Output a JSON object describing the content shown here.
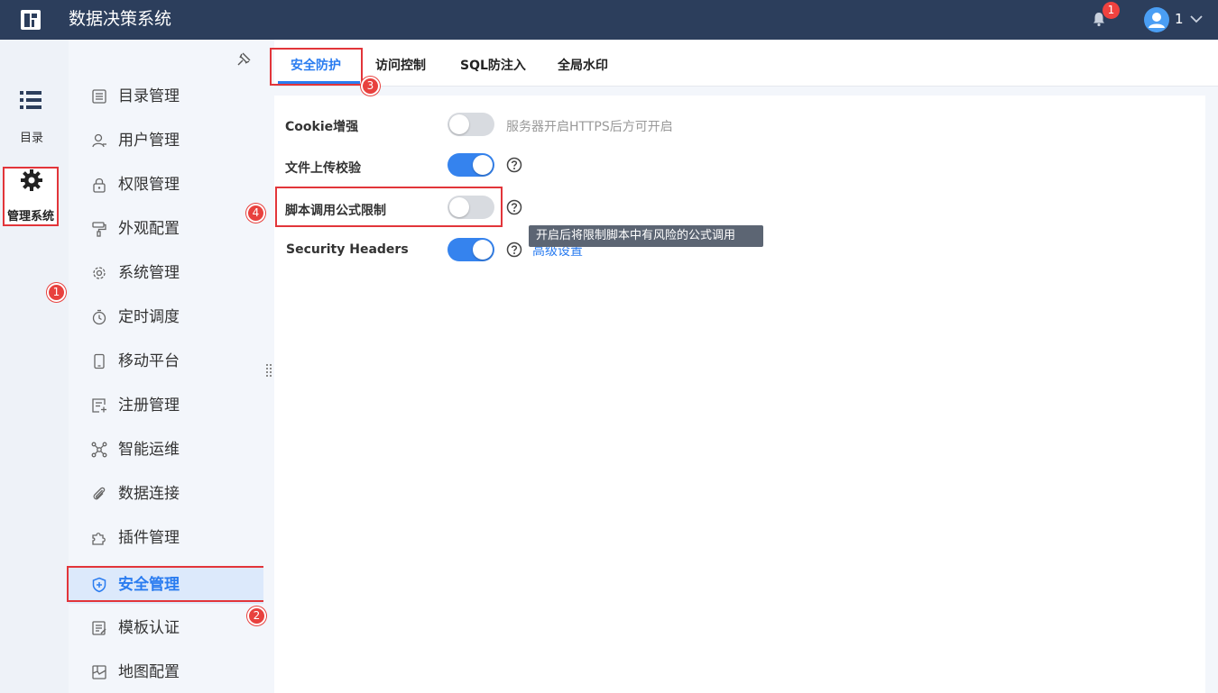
{
  "header": {
    "app_title": "数据决策系统",
    "notification_count": "1",
    "user_name": "1"
  },
  "rail": {
    "catalog_label": "目录",
    "admin_label": "管理系统"
  },
  "sidebar": {
    "items": [
      {
        "label": "目录管理",
        "icon": "list-doc-icon"
      },
      {
        "label": "用户管理",
        "icon": "user-icon"
      },
      {
        "label": "权限管理",
        "icon": "lock-icon"
      },
      {
        "label": "外观配置",
        "icon": "paint-roller-icon"
      },
      {
        "label": "系统管理",
        "icon": "gear-icon"
      },
      {
        "label": "定时调度",
        "icon": "timer-icon"
      },
      {
        "label": "移动平台",
        "icon": "mobile-icon"
      },
      {
        "label": "注册管理",
        "icon": "register-icon"
      },
      {
        "label": "智能运维",
        "icon": "network-icon"
      },
      {
        "label": "数据连接",
        "icon": "paperclip-icon"
      },
      {
        "label": "插件管理",
        "icon": "puzzle-icon"
      },
      {
        "label": "安全管理",
        "icon": "shield-icon",
        "active": true
      },
      {
        "label": "模板认证",
        "icon": "template-icon"
      },
      {
        "label": "地图配置",
        "icon": "map-icon"
      }
    ]
  },
  "tabs": [
    {
      "label": "安全防护",
      "active": true
    },
    {
      "label": "访问控制"
    },
    {
      "label": "SQL防注入"
    },
    {
      "label": "全局水印"
    }
  ],
  "settings": {
    "cookie": {
      "label": "Cookie增强",
      "enabled": false,
      "hint": "服务器开启HTTPS后方可开启"
    },
    "upload": {
      "label": "文件上传校验",
      "enabled": true
    },
    "script": {
      "label": "脚本调用公式限制",
      "enabled": false
    },
    "headers": {
      "label": "Security Headers",
      "enabled": true,
      "link": "高级设置"
    }
  },
  "tooltip": "开启后将限制脚本中有风险的公式调用",
  "markers": [
    "1",
    "2",
    "3",
    "4"
  ],
  "colors": {
    "header_bg": "#2c3e5c",
    "accent": "#2a7cf0",
    "marker": "#e8413e",
    "toggle_on": "#3583ee",
    "toggle_off": "#d8dbe0"
  }
}
